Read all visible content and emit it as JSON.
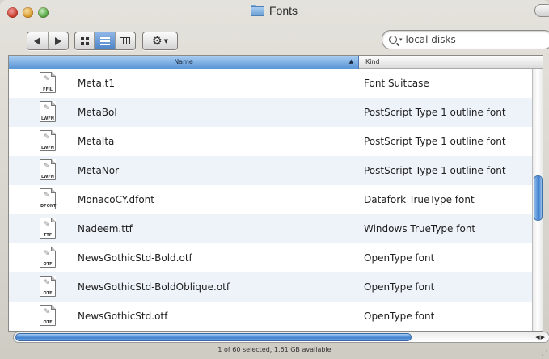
{
  "window": {
    "title": "Fonts"
  },
  "toolbar": {
    "search": {
      "value": "local disks",
      "placeholder": ""
    }
  },
  "columns": {
    "name": "Name",
    "kind": "Kind"
  },
  "files": [
    {
      "icon_code": "FFIL",
      "name": "Meta.t1",
      "kind": "Font Suitcase"
    },
    {
      "icon_code": "LWFN",
      "name": "MetaBol",
      "kind": "PostScript Type 1 outline font"
    },
    {
      "icon_code": "LWFN",
      "name": "MetaIta",
      "kind": "PostScript Type 1 outline font"
    },
    {
      "icon_code": "LWFN",
      "name": "MetaNor",
      "kind": "PostScript Type 1 outline font"
    },
    {
      "icon_code": "DFONT",
      "name": "MonacoCY.dfont",
      "kind": "Datafork TrueType font"
    },
    {
      "icon_code": "TTF",
      "name": "Nadeem.ttf",
      "kind": "Windows TrueType font"
    },
    {
      "icon_code": "OTF",
      "name": "NewsGothicStd-Bold.otf",
      "kind": "OpenType font"
    },
    {
      "icon_code": "OTF",
      "name": "NewsGothicStd-BoldOblique.otf",
      "kind": "OpenType font"
    },
    {
      "icon_code": "OTF",
      "name": "NewsGothicStd.otf",
      "kind": "OpenType font"
    }
  ],
  "status": "1 of 60 selected, 1.61 GB available",
  "colors": {
    "selection_blue": "#5a95d6",
    "window_gray": "#d6d3cc"
  }
}
